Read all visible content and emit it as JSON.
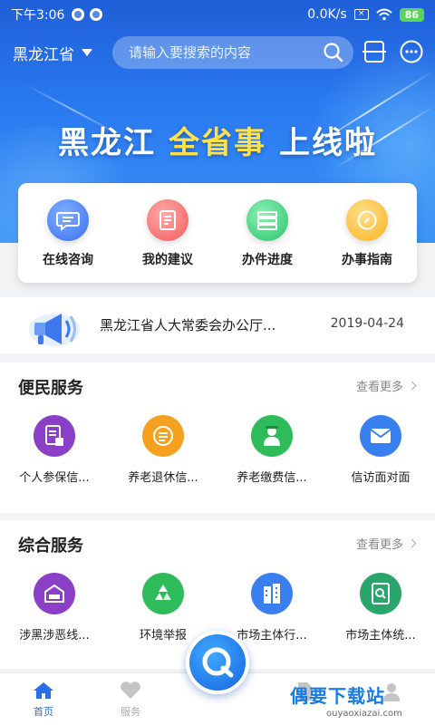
{
  "status": {
    "time": "下午3:06",
    "speed": "0.0K/s",
    "battery": "86"
  },
  "header": {
    "province": "黑龙江省",
    "search_placeholder": "请输入要搜索的内容",
    "banner_part1": "黑龙江",
    "banner_highlight": "全省事",
    "banner_part2": "上线啦"
  },
  "quick_actions": [
    {
      "label": "在线咨询",
      "icon": "chat-bubble-icon"
    },
    {
      "label": "我的建议",
      "icon": "document-icon"
    },
    {
      "label": "办件进度",
      "icon": "progress-list-icon"
    },
    {
      "label": "办事指南",
      "icon": "compass-icon"
    }
  ],
  "notice": {
    "text": "黑龙江省人大常委会办公厅...",
    "date": "2019-04-24"
  },
  "convenience": {
    "title": "便民服务",
    "more": "查看更多",
    "items": [
      {
        "label": "个人参保信..."
      },
      {
        "label": "养老退休信..."
      },
      {
        "label": "养老缴费信..."
      },
      {
        "label": "信访面对面"
      }
    ]
  },
  "comprehensive": {
    "title": "综合服务",
    "more": "查看更多",
    "items": [
      {
        "label": "涉黑涉恶线..."
      },
      {
        "label": "环境举报"
      },
      {
        "label": "市场主体行..."
      },
      {
        "label": "市场主体统..."
      }
    ]
  },
  "bottom_nav": {
    "home": "首页",
    "service": "服务"
  },
  "watermark": {
    "name": "偶要下载站",
    "url": "ouyaoxiazai.com"
  },
  "colors": {
    "primary": "#2a6fe8",
    "accent_yellow": "#ffe14a"
  }
}
